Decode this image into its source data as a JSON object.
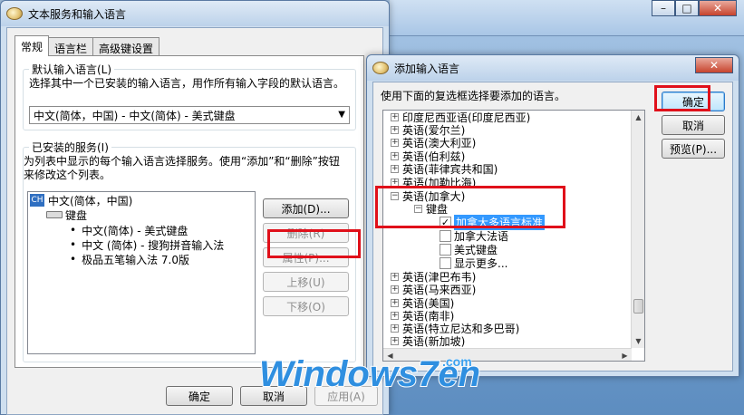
{
  "bg_window": {
    "minimize": "–",
    "maximize": "□",
    "close": "✕"
  },
  "main_dialog": {
    "title": "文本服务和输入语言",
    "tabs": [
      "常规",
      "语言栏",
      "高级键设置"
    ],
    "default_lang": {
      "label": "默认输入语言(L)",
      "desc": "选择其中一个已安装的输入语言，用作所有输入字段的默认语言。",
      "value": "中文(简体，中国) - 中文(简体) - 美式键盘"
    },
    "installed": {
      "label": "已安装的服务(I)",
      "desc": "为列表中显示的每个输入语言选择服务。使用“添加”和“删除”按钮来修改这个列表。",
      "tree": {
        "lang": "中文(简体，中国)",
        "lang_code": "CH",
        "group": "键盘",
        "items": [
          "中文(简体) - 美式键盘",
          "中文 (简体) - 搜狗拼音输入法",
          "极品五笔输入法 7.0版"
        ]
      }
    },
    "buttons": {
      "add": "添加(D)...",
      "remove": "删除(R)",
      "properties": "属性(P)...",
      "move_up": "上移(U)",
      "move_down": "下移(O)"
    },
    "footer": {
      "ok": "确定",
      "cancel": "取消",
      "apply": "应用(A)"
    }
  },
  "add_dialog": {
    "title": "添加输入语言",
    "instruction": "使用下面的复选框选择要添加的语言。",
    "buttons": {
      "ok": "确定",
      "cancel": "取消",
      "preview": "预览(P)..."
    },
    "tree": [
      {
        "label": "印度尼西亚语(印度尼西亚)",
        "expander": "+"
      },
      {
        "label": "英语(爱尔兰)",
        "expander": "+"
      },
      {
        "label": "英语(澳大利亚)",
        "expander": "+"
      },
      {
        "label": "英语(伯利兹)",
        "expander": "+"
      },
      {
        "label": "英语(菲律宾共和国)",
        "expander": "+"
      },
      {
        "label": "英语(加勒比海)",
        "expander": "+"
      },
      {
        "label": "英语(加拿大)",
        "expander": "−"
      },
      {
        "label": "英语(津巴布韦)",
        "expander": "+"
      },
      {
        "label": "英语(马来西亚)",
        "expander": "+"
      },
      {
        "label": "英语(美国)",
        "expander": "+"
      },
      {
        "label": "英语(南非)",
        "expander": "+"
      },
      {
        "label": "英语(特立尼达和多巴哥)",
        "expander": "+"
      },
      {
        "label": "英语(新加坡)",
        "expander": "+"
      },
      {
        "label": "英语(新西兰)",
        "expander": "+"
      }
    ],
    "canada": {
      "group": "键盘",
      "group_expander": "−",
      "options": [
        {
          "label": "加拿大多语言标准",
          "checked": true,
          "check": "✓"
        },
        {
          "label": "加拿大法语",
          "checked": false,
          "check": ""
        },
        {
          "label": "美式键盘",
          "checked": false,
          "check": ""
        },
        {
          "label": "显示更多...",
          "checked": false,
          "check": ""
        }
      ]
    }
  },
  "watermark": {
    "brand": "Windows7en",
    "domain": ".com"
  }
}
